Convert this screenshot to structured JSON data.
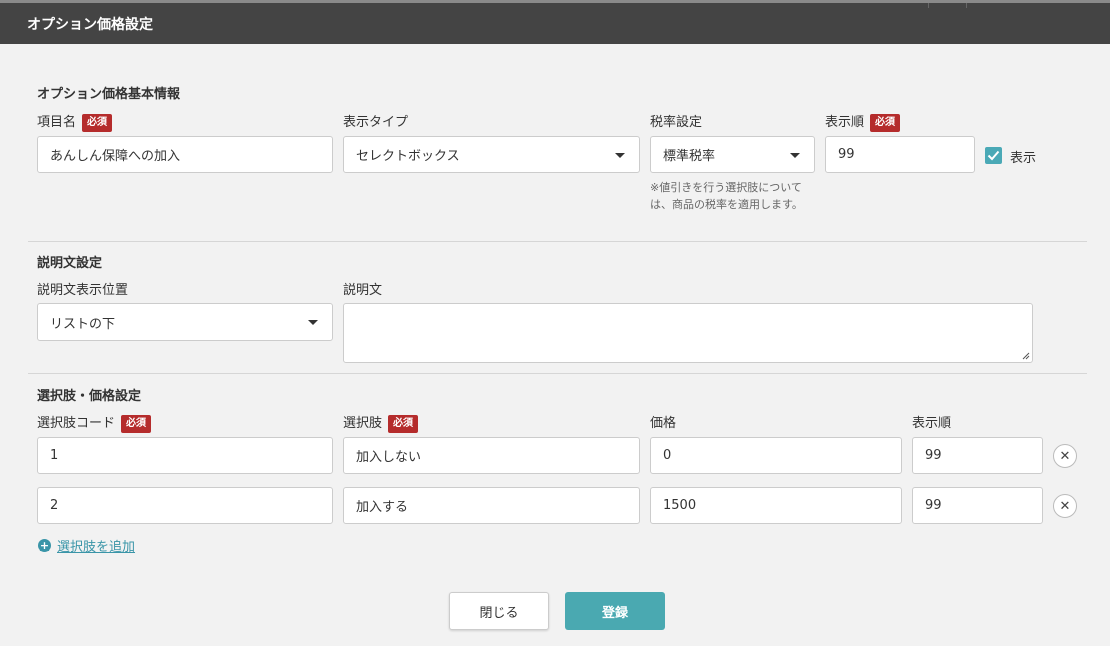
{
  "header": {
    "title": "オプション価格設定"
  },
  "basic": {
    "section_title": "オプション価格基本情報",
    "item_name_label": "項目名",
    "item_name_value": "あんしん保障への加入",
    "display_type_label": "表示タイプ",
    "display_type_value": "セレクトボックス",
    "tax_label": "税率設定",
    "tax_value": "標準税率",
    "tax_note": "※値引きを行う選択肢については、商品の税率を適用します。",
    "order_label": "表示順",
    "order_value": "99",
    "visible_label": "表示",
    "visible_checked": true
  },
  "required_badge": "必須",
  "description": {
    "section_title": "説明文設定",
    "position_label": "説明文表示位置",
    "position_value": "リストの下",
    "text_label": "説明文",
    "text_value": ""
  },
  "options": {
    "section_title": "選択肢・価格設定",
    "headers": {
      "code": "選択肢コード",
      "choice": "選択肢",
      "price": "価格",
      "order": "表示順"
    },
    "rows": [
      {
        "code": "1",
        "choice": "加入しない",
        "price": "0",
        "order": "99"
      },
      {
        "code": "2",
        "choice": "加入する",
        "price": "1500",
        "order": "99"
      }
    ],
    "add_label": "選択肢を追加"
  },
  "buttons": {
    "close": "閉じる",
    "submit": "登録"
  },
  "icons": {
    "remove": "close-icon",
    "add": "plus-circle-icon",
    "caret": "caret-down-icon",
    "check": "checkmark-icon"
  },
  "colors": {
    "accent": "#4aa9b1",
    "required": "#b52c2c",
    "header_bg": "#444444",
    "link": "#3a95a8"
  }
}
